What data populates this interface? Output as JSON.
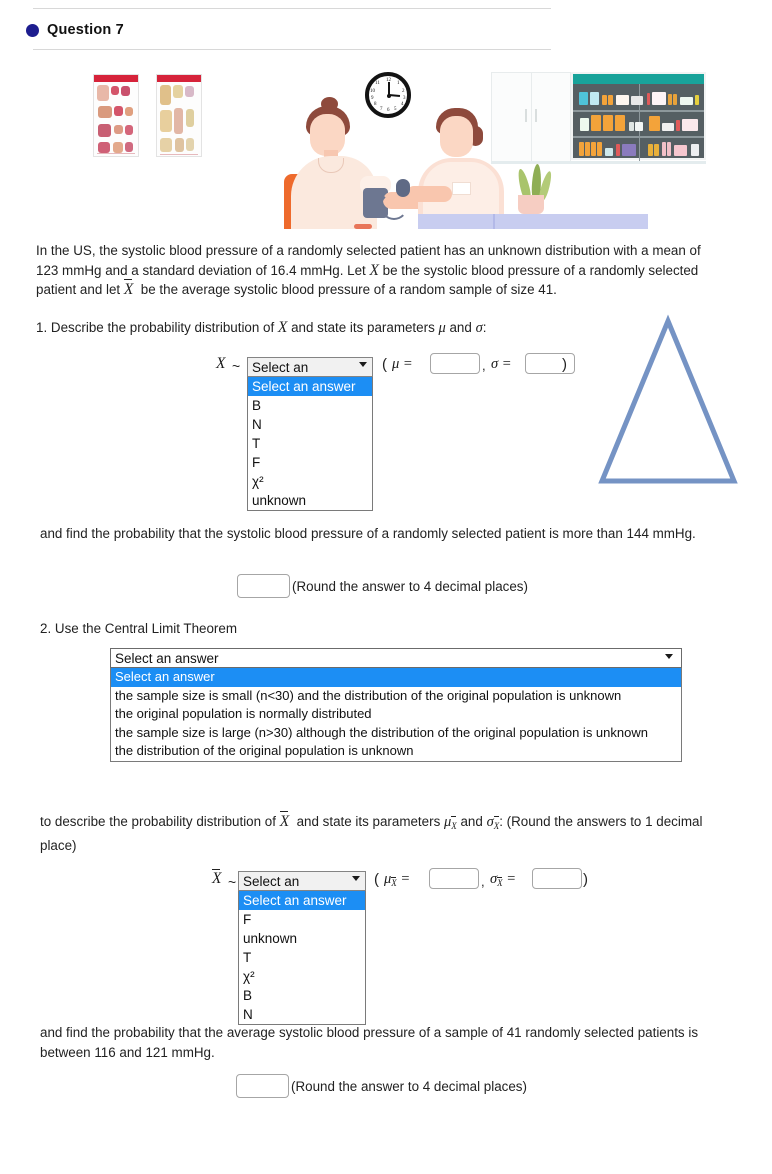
{
  "header": {
    "question_label": "Question 7",
    "dot_color": "#1d1d8f"
  },
  "illustration": {
    "alt": "clinic-blood-pressure-illustration",
    "clock_numbers": [
      "12",
      "1",
      "2",
      "3",
      "4",
      "5",
      "6",
      "7",
      "8",
      "9",
      "10",
      "11"
    ]
  },
  "problem": {
    "paragraph": "In the US, the systolic blood pressure of a randomly selected patient has an unknown distribution with a mean of 123 mmHg and a standard deviation of 16.4 mmHg. Let ",
    "paragraph_2": " be the systolic blood pressure of a randomly selected patient and let ",
    "paragraph_3": " be the average systolic blood pressure of a random sample of size 41.",
    "mean": "123 mmHg",
    "sd": "16.4 mmHg",
    "sample_size": "41"
  },
  "part1": {
    "number": "1.",
    "prompt_a": "Describe the probability distribution of ",
    "prompt_b": " and state its parameters ",
    "prompt_mu": "μ",
    "prompt_and": " and ",
    "prompt_sigma": "σ",
    "prompt_colon": ":",
    "var": "X",
    "tilde": "~",
    "select_value": "Select an answer",
    "paren_open": "(",
    "mu_label": "μ =",
    "comma": ",",
    "sigma_label": "σ =",
    "paren_close": ")",
    "mu_value": "",
    "sigma_value": "",
    "options": [
      "Select an answer",
      "B",
      "N",
      "T",
      "F",
      "χ²",
      "unknown"
    ],
    "follow_text": "and find the probability that the systolic blood pressure of a randomly selected patient is more than 144 mmHg.",
    "answer_value": "",
    "round_note": "(Round the answer to 4 decimal places)"
  },
  "part2": {
    "number": "2.",
    "prompt": "Use the Central Limit Theorem",
    "select_value": "Select an answer",
    "options": [
      "Select an answer",
      "the sample size is small (n<30) and the distribution of the original population is unknown",
      "the original population is normally distributed",
      "the sample size is large (n>30) although the distribution of the original population is unknown",
      "the distribution of the original population is unknown"
    ],
    "describe_a": "to describe the probability distribution of ",
    "describe_b": " and state its parameters ",
    "describe_mu": "μ",
    "describe_and": " and ",
    "describe_sigma": "σ",
    "describe_c": ": (Round the answers to 1 decimal place)",
    "var": "X",
    "tilde": "~",
    "xbar_select_value": "Select an answer",
    "xbar_options": [
      "Select an answer",
      "F",
      "unknown",
      "T",
      "χ²",
      "B",
      "N"
    ],
    "paren_open": "(",
    "mu_label": "μ",
    "mu_sub": "X",
    "eq": "=",
    "comma": ",",
    "sigma_label": "σ",
    "sigma_sub": "X",
    "paren_close": ")",
    "mu_value": "",
    "sigma_value": "",
    "follow_text": "and find the probability that the average systolic blood pressure of a sample of 41 randomly selected patients is between 116 and 121 mmHg.",
    "answer_value": "",
    "round_note": "(Round the answer to 4 decimal places)"
  },
  "colors": {
    "highlight": "#1c8ef4",
    "triangle_stroke": "#7593c4",
    "accent_red": "#d6233a"
  }
}
